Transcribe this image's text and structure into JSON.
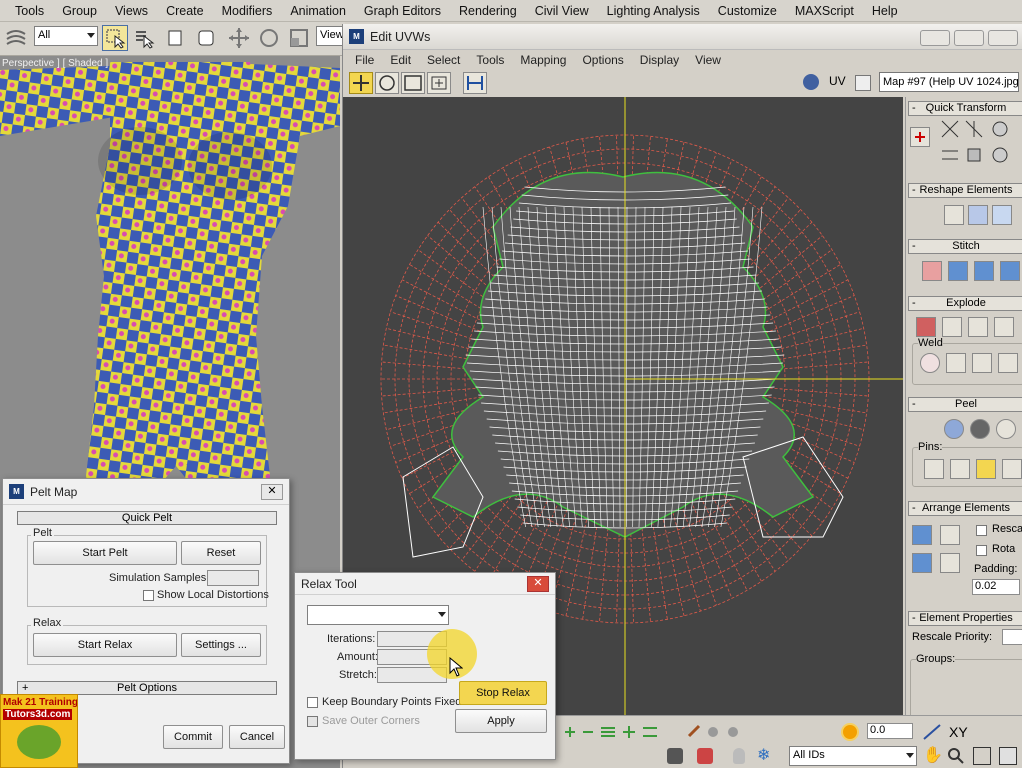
{
  "main_menu": [
    "Tools",
    "Group",
    "Views",
    "Create",
    "Modifiers",
    "Animation",
    "Graph Editors",
    "Rendering",
    "Civil View",
    "Lighting Analysis",
    "Customize",
    "MAXScript",
    "Help"
  ],
  "toolbar": {
    "selection_filter": "All",
    "view_dropdown": "View"
  },
  "viewport": {
    "label": "Perspective ] [ Shaded ]"
  },
  "edit_uvws": {
    "title": "Edit UVWs",
    "menu": [
      "File",
      "Edit",
      "Select",
      "Tools",
      "Mapping",
      "Options",
      "Display",
      "View"
    ],
    "uv_label": "UV",
    "map_select": "Map #97 (Help UV 1024.jpg)"
  },
  "rollouts": {
    "quick_transform": "Quick Transform",
    "reshape_elements": "Reshape Elements",
    "stitch": "Stitch",
    "explode": "Explode",
    "weld": "Weld",
    "peel": "Peel",
    "pins": "Pins:",
    "arrange_elements": "Arrange Elements",
    "rescale": "Resca",
    "rotate": "Rota",
    "padding_label": "Padding:",
    "padding_value": "0.02",
    "element_properties": "Element Properties",
    "rescale_priority": "Rescale Priority:",
    "groups": "Groups:"
  },
  "uv_bottom": {
    "spinner_value": "0.0",
    "xy_label": "XY",
    "ids_select": "All IDs"
  },
  "pelt_map": {
    "title": "Pelt Map",
    "quick_pelt": "Quick Pelt",
    "pelt_group": "Pelt",
    "start_pelt": "Start Pelt",
    "reset": "Reset",
    "simulation_samples": "Simulation Samples:",
    "show_local_distortions": "Show Local Distortions",
    "relax_group": "Relax",
    "start_relax": "Start Relax",
    "settings": "Settings ...",
    "pelt_options": "Pelt Options",
    "commit": "Commit",
    "cancel": "Cancel"
  },
  "relax_tool": {
    "title": "Relax Tool",
    "iterations": "Iterations:",
    "amount": "Amount:",
    "stretch": "Stretch:",
    "keep_boundary": "Keep Boundary Points Fixed",
    "save_outer": "Save Outer Corners",
    "stop_relax": "Stop Relax",
    "apply": "Apply"
  },
  "logo": {
    "line1": "Mak 21 Training",
    "line2": "Tutors3d.com"
  },
  "colors": {
    "uv_background": "#444444",
    "mesh_white": "#ffffff",
    "mesh_red": "#e05a4a",
    "mesh_green": "#3fbf3f",
    "axis_yellow": "#e8e020",
    "checker_yellow": "#e4d93a",
    "checker_blue": "#3c5bb5"
  }
}
